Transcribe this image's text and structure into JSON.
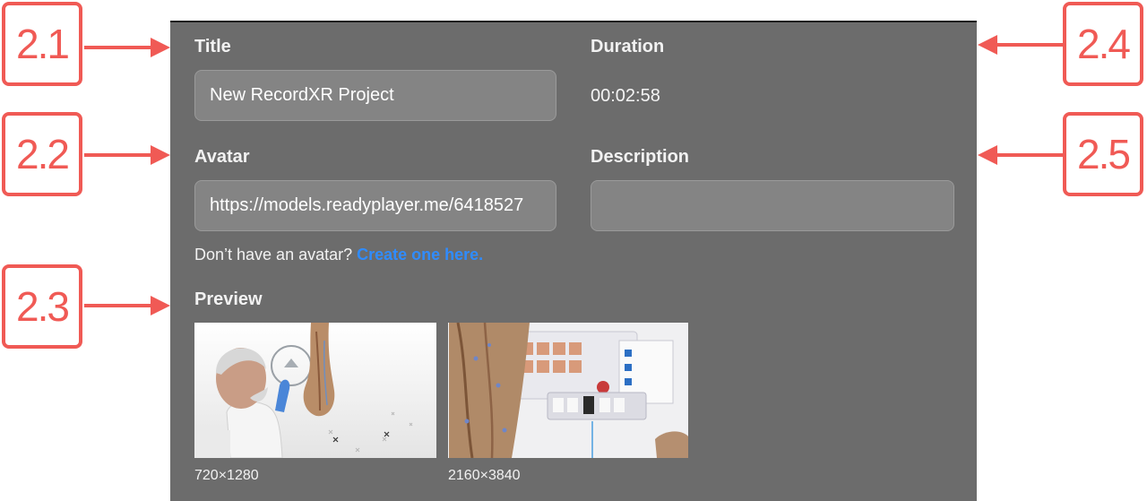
{
  "title": {
    "label": "Title",
    "value": "New RecordXR Project"
  },
  "duration": {
    "label": "Duration",
    "value": "00:02:58"
  },
  "avatar": {
    "label": "Avatar",
    "value": "https://models.readyplayer.me/6418527",
    "hint_text": "Don’t have an avatar? ",
    "hint_link": "Create one here."
  },
  "description": {
    "label": "Description",
    "value": ""
  },
  "preview": {
    "label": "Preview",
    "thumbnails": [
      {
        "resolution": "720×1280"
      },
      {
        "resolution": "2160×3840"
      }
    ]
  },
  "callouts": [
    "2.1",
    "2.2",
    "2.3",
    "2.4",
    "2.5"
  ],
  "colors": {
    "callout": "#f05a55",
    "panel": "#6c6c6c",
    "link": "#2f8cff",
    "field": "#848484"
  }
}
